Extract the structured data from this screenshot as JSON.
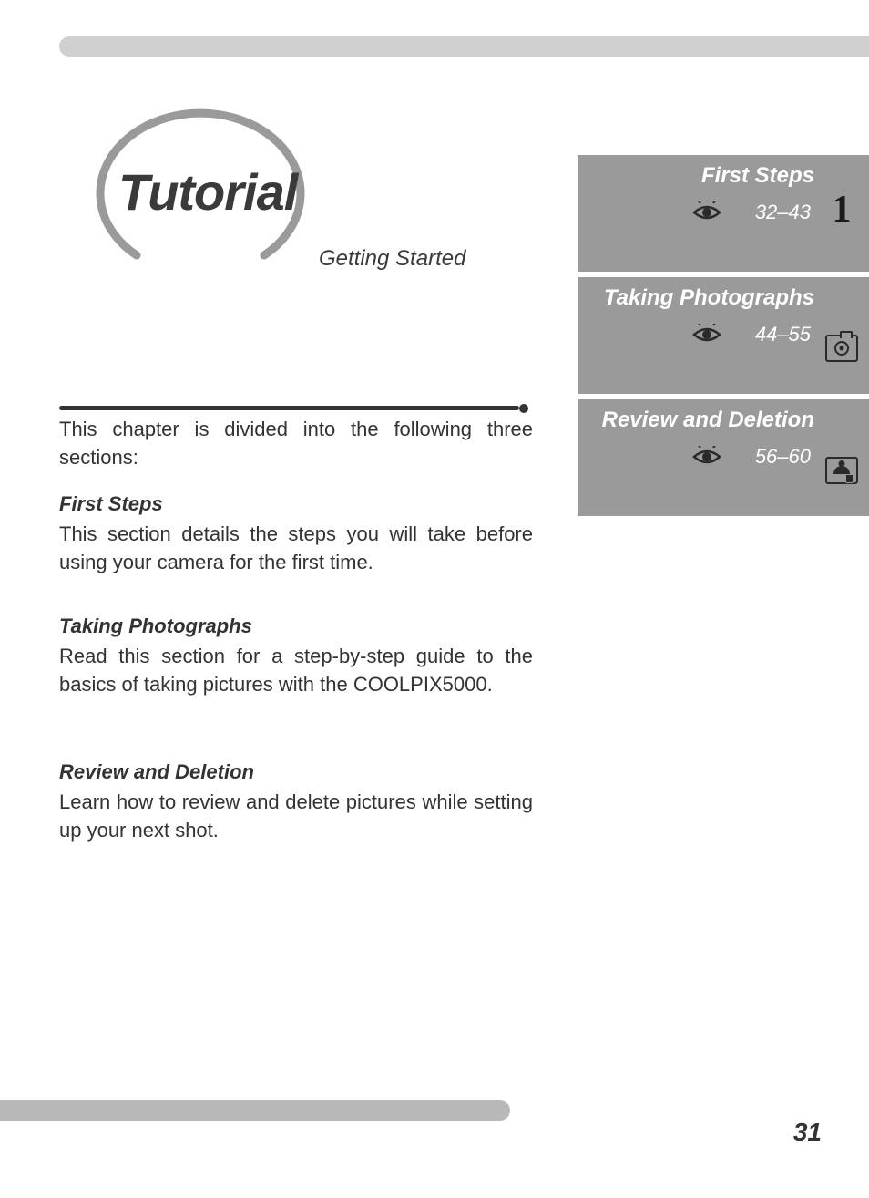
{
  "header": {
    "title": "Tutorial",
    "subtitle": "Getting Started"
  },
  "intro": "This chapter is divided into the following three sections:",
  "sections": [
    {
      "title": "First Steps",
      "body": "This section details the steps you will take before using your camera for the first time."
    },
    {
      "title": "Taking Photographs",
      "body": "Read this section for a step-by-step guide to the basics of taking pictures with the COOLPIX5000."
    },
    {
      "title": "Review and Deletion",
      "body": "Learn how to review and delete pictures while setting up your next shot."
    }
  ],
  "nav": [
    {
      "title": "First Steps",
      "pages": "32–43",
      "icon": "number-1"
    },
    {
      "title": "Taking Photographs",
      "pages": "44–55",
      "icon": "camera"
    },
    {
      "title": "Review and Deletion",
      "pages": "56–60",
      "icon": "review"
    }
  ],
  "page_number": "31"
}
